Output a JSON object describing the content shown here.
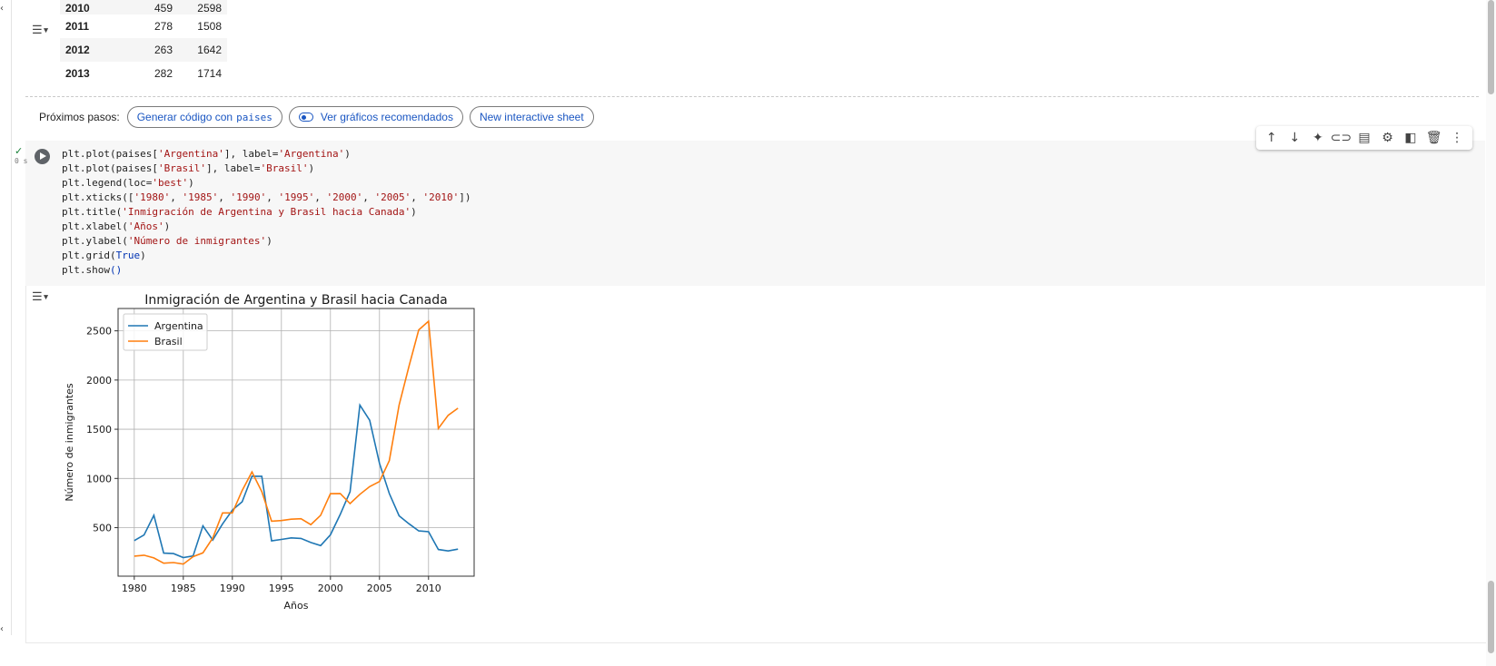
{
  "table": {
    "rows": [
      {
        "year": "2010",
        "argentina": "459",
        "brasil": "2598"
      },
      {
        "year": "2011",
        "argentina": "278",
        "brasil": "1508"
      },
      {
        "year": "2012",
        "argentina": "263",
        "brasil": "1642"
      },
      {
        "year": "2013",
        "argentina": "282",
        "brasil": "1714"
      }
    ]
  },
  "next_steps": {
    "label": "Próximos pasos:",
    "chip_generate_prefix": "Generar código con",
    "chip_generate_var": "paises",
    "chip_recommended": "Ver gráficos recomendados",
    "chip_sheet": "New interactive sheet"
  },
  "cell": {
    "exec_status": "✓",
    "exec_time": "0 s",
    "code_lines": [
      "plt.plot(paises['Argentina'], label='Argentina')",
      "plt.plot(paises['Brasil'], label='Brasil')",
      "plt.legend(loc='best')",
      "plt.xticks(['1980', '1985', '1990', '1995', '2000', '2005', '2010'])",
      "plt.title('Inmigración de Argentina y Brasil hacia Canada')",
      "plt.xlabel('Años')",
      "plt.ylabel('Número de inmigrantes')",
      "plt.grid(True)",
      "plt.show()"
    ]
  },
  "toolbar": {
    "icons": [
      "arrow-up-icon",
      "arrow-down-icon",
      "sparkle-icon",
      "link-icon",
      "comment-icon",
      "gear-icon",
      "mirror-cell-icon",
      "trash-icon",
      "more-vert-icon"
    ]
  },
  "chart_data": {
    "type": "line",
    "title": "Inmigración de Argentina y Brasil hacia Canada",
    "xlabel": "Años",
    "ylabel": "Número de inmigrantes",
    "xlim": [
      1978.35,
      2014.65
    ],
    "ylim": [
      7,
      2727
    ],
    "xticks": [
      1980,
      1985,
      1990,
      1995,
      2000,
      2005,
      2010
    ],
    "yticks": [
      500,
      1000,
      1500,
      2000,
      2500
    ],
    "grid": true,
    "legend_position": "upper-left",
    "x": [
      1980,
      1981,
      1982,
      1983,
      1984,
      1985,
      1986,
      1987,
      1988,
      1989,
      1990,
      1991,
      1992,
      1993,
      1994,
      1995,
      1996,
      1997,
      1998,
      1999,
      2000,
      2001,
      2002,
      2003,
      2004,
      2005,
      2006,
      2007,
      2008,
      2009,
      2010,
      2011,
      2012,
      2013
    ],
    "series": [
      {
        "name": "Argentina",
        "color": "#1f77b4",
        "values": [
          368,
          426,
          626,
          241,
          237,
          196,
          213,
          519,
          374,
          538,
          678,
          763,
          1023,
          1022,
          366,
          380,
          396,
          391,
          349,
          318,
          427,
          635,
          865,
          1745,
          1591,
          1153,
          847,
          620,
          540,
          467,
          459,
          278,
          263,
          282
        ]
      },
      {
        "name": "Brasil",
        "color": "#ff7f0e",
        "values": [
          211,
          220,
          192,
          139,
          145,
          130,
          205,
          244,
          394,
          650,
          650,
          877,
          1066,
          866,
          566,
          572,
          586,
          591,
          531,
          626,
          845,
          847,
          745,
          839,
          917,
          969,
          1181,
          1746,
          2138,
          2509,
          2598,
          1508,
          1642,
          1714
        ]
      }
    ]
  }
}
